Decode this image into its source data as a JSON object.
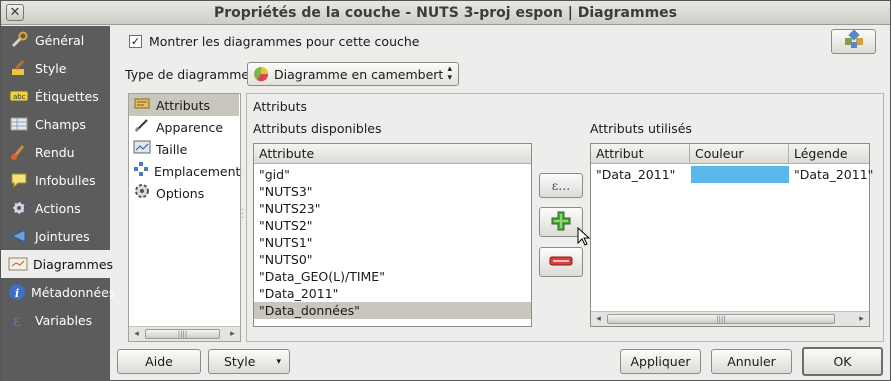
{
  "window": {
    "title": "Propriétés de la couche - NUTS 3-proj espon | Diagrammes",
    "close_glyph": "✕"
  },
  "sidebar": {
    "items": [
      {
        "label": "Général",
        "icon": "wrench-icon"
      },
      {
        "label": "Style",
        "icon": "brush-icon"
      },
      {
        "label": "Étiquettes",
        "icon": "labels-icon"
      },
      {
        "label": "Champs",
        "icon": "table-icon"
      },
      {
        "label": "Rendu",
        "icon": "paintbrush-icon"
      },
      {
        "label": "Infobulles",
        "icon": "speech-bubble-icon"
      },
      {
        "label": "Actions",
        "icon": "gear-icon"
      },
      {
        "label": "Jointures",
        "icon": "join-icon"
      },
      {
        "label": "Diagrammes",
        "icon": "diagram-icon"
      },
      {
        "label": "Métadonnées",
        "icon": "info-icon"
      },
      {
        "label": "Variables",
        "icon": "epsilon-icon"
      }
    ],
    "selected": "Diagrammes"
  },
  "top": {
    "show_diagrams_label": "Montrer les diagrammes pour cette couche",
    "show_diagrams_checked": true
  },
  "diagram_type": {
    "label": "Type de diagramme",
    "value": "Diagramme en camembert"
  },
  "tabs": [
    {
      "label": "Attributs",
      "icon": "attributes-icon"
    },
    {
      "label": "Apparence",
      "icon": "pen-icon"
    },
    {
      "label": "Taille",
      "icon": "size-icon"
    },
    {
      "label": "Emplacement",
      "icon": "placement-icon"
    },
    {
      "label": "Options",
      "icon": "options-gear-icon"
    }
  ],
  "selected_tab": "Attributs",
  "content": {
    "heading": "Attributs",
    "available_label": "Attributs disponibles",
    "used_label": "Attributs utilisés",
    "available": {
      "header": "Attribute",
      "rows": [
        "\"gid\"",
        "\"NUTS3\"",
        "\"NUTS23\"",
        "\"NUTS2\"",
        "\"NUTS1\"",
        "\"NUTS0\"",
        "\"Data_GEO(L)/TIME\"",
        "\"Data_2011\"",
        "\"Data_données\""
      ],
      "selected_row": "\"Data_données\""
    },
    "used": {
      "headers": [
        "Attribut",
        "Couleur",
        "Légende"
      ],
      "rows": [
        {
          "attribut": "\"Data_2011\"",
          "couleur": "#5bb8ea",
          "legende": "\"Data_2011\""
        }
      ]
    },
    "expression_button": "ε...",
    "add_glyph": "+",
    "remove_glyph": "−"
  },
  "footer": {
    "help": "Aide",
    "style": "Style",
    "apply": "Appliquer",
    "cancel": "Annuler",
    "ok": "OK"
  },
  "colors": {
    "sidebar_bg": "#5c5c5c",
    "selected_row": "#c9c6bd",
    "add_green": "#3f9a2f",
    "remove_red": "#d23a36"
  }
}
